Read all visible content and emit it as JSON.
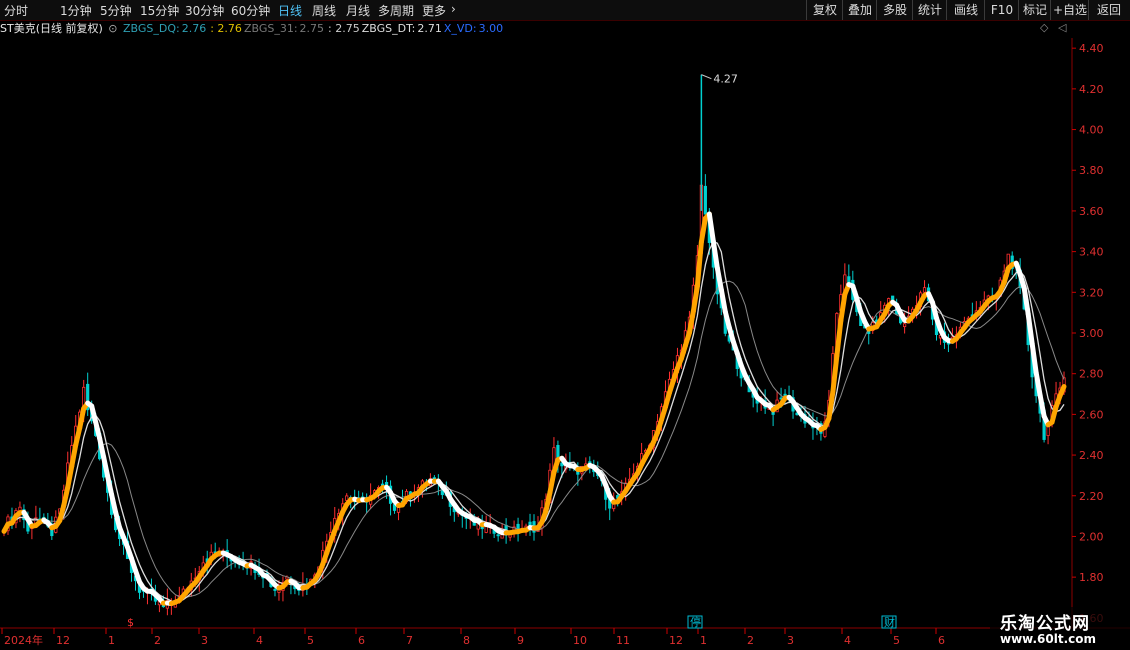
{
  "toolbar": {
    "periods": [
      "分时",
      "1分钟",
      "5分钟",
      "15分钟",
      "30分钟",
      "60分钟",
      "日线",
      "周线",
      "月线",
      "多周期",
      "更多"
    ],
    "active_period": "日线",
    "right_buttons": [
      "复权",
      "叠加",
      "多股",
      "统计",
      "画线",
      "F10",
      "标记",
      "+自选",
      "返回"
    ]
  },
  "legend": {
    "stock": "ST美克(日线 前复权)",
    "items": [
      {
        "name": "ZBGS_DQ:",
        "value": "2.76",
        "name_color": "#2e9fb3",
        "value_color": "#2e9fb3"
      },
      {
        "name": "",
        "value": ": 2.76",
        "name_color": "#e0c000",
        "value_color": "#e0c000"
      },
      {
        "name": "ZBGS_31:",
        "value": "2.75",
        "name_color": "#777777",
        "value_color": "#777777"
      },
      {
        "name": "",
        "value": ": 2.75",
        "name_color": "#cccccc",
        "value_color": "#cccccc"
      },
      {
        "name": "ZBGS_DT:",
        "value": "2.71",
        "name_color": "#dddddd",
        "value_color": "#dddddd"
      },
      {
        "name": "X_VD:",
        "value": "3.00",
        "name_color": "#2a6bff",
        "value_color": "#2a6bff"
      }
    ]
  },
  "chart_data": {
    "type": "candlestick",
    "ylim": [
      1.55,
      4.45
    ],
    "y_ticks": [
      "4.40",
      "4.20",
      "4.00",
      "3.80",
      "3.60",
      "3.40",
      "3.20",
      "3.00",
      "2.80",
      "2.60",
      "2.40",
      "2.20",
      "2.00",
      "1.80",
      "1.60"
    ],
    "x_labels": [
      "2024年",
      "12",
      "1",
      "2",
      "3",
      "4",
      "5",
      "6",
      "7",
      "8",
      "9",
      "10",
      "11",
      "12",
      "1",
      "2",
      "3",
      "4",
      "5",
      "6"
    ],
    "max_label": "4.27",
    "events": [
      {
        "text": "$",
        "month": "1",
        "color": "#ff3333"
      },
      {
        "text": "停",
        "month": "1",
        "color": "#00bcd4"
      },
      {
        "text": "财",
        "month": "4",
        "color": "#00bcd4"
      }
    ],
    "anchors": [
      [
        0,
        2.05
      ],
      [
        4,
        2.15
      ],
      [
        6,
        2.02
      ],
      [
        8,
        2.1
      ],
      [
        10,
        2.05
      ],
      [
        12,
        2.02
      ],
      [
        14,
        2.12
      ],
      [
        17,
        2.45
      ],
      [
        19,
        2.62
      ],
      [
        20,
        2.72
      ],
      [
        21,
        2.62
      ],
      [
        23,
        2.5
      ],
      [
        25,
        2.3
      ],
      [
        28,
        2.05
      ],
      [
        31,
        1.88
      ],
      [
        34,
        1.74
      ],
      [
        37,
        1.7
      ],
      [
        40,
        1.65
      ],
      [
        44,
        1.7
      ],
      [
        47,
        1.78
      ],
      [
        50,
        1.88
      ],
      [
        53,
        1.92
      ],
      [
        56,
        1.9
      ],
      [
        59,
        1.88
      ],
      [
        62,
        1.86
      ],
      [
        65,
        1.82
      ],
      [
        68,
        1.74
      ],
      [
        71,
        1.8
      ],
      [
        74,
        1.75
      ],
      [
        77,
        1.78
      ],
      [
        80,
        1.92
      ],
      [
        83,
        2.1
      ],
      [
        86,
        2.2
      ],
      [
        89,
        2.16
      ],
      [
        92,
        2.2
      ],
      [
        95,
        2.24
      ],
      [
        98,
        2.15
      ],
      [
        101,
        2.2
      ],
      [
        104,
        2.24
      ],
      [
        107,
        2.28
      ],
      [
        110,
        2.22
      ],
      [
        114,
        2.12
      ],
      [
        118,
        2.06
      ],
      [
        122,
        2.04
      ],
      [
        126,
        2.02
      ],
      [
        130,
        2.03
      ],
      [
        134,
        2.05
      ],
      [
        136,
        2.2
      ],
      [
        138,
        2.42
      ],
      [
        140,
        2.35
      ],
      [
        143,
        2.32
      ],
      [
        146,
        2.34
      ],
      [
        149,
        2.3
      ],
      [
        152,
        2.16
      ],
      [
        155,
        2.2
      ],
      [
        158,
        2.32
      ],
      [
        161,
        2.42
      ],
      [
        163,
        2.52
      ],
      [
        166,
        2.7
      ],
      [
        169,
        2.88
      ],
      [
        172,
        3.06
      ],
      [
        174,
        3.38
      ],
      [
        175,
        3.72
      ],
      [
        176,
        3.6
      ],
      [
        178,
        3.3
      ],
      [
        181,
        3.0
      ],
      [
        184,
        2.85
      ],
      [
        187,
        2.7
      ],
      [
        190,
        2.66
      ],
      [
        193,
        2.62
      ],
      [
        196,
        2.7
      ],
      [
        199,
        2.6
      ],
      [
        202,
        2.56
      ],
      [
        205,
        2.5
      ],
      [
        207,
        2.65
      ],
      [
        209,
        3.1
      ],
      [
        211,
        3.3
      ],
      [
        213,
        3.15
      ],
      [
        216,
        3.0
      ],
      [
        219,
        3.05
      ],
      [
        222,
        3.18
      ],
      [
        225,
        3.05
      ],
      [
        228,
        3.1
      ],
      [
        231,
        3.22
      ],
      [
        234,
        3.0
      ],
      [
        237,
        2.95
      ],
      [
        240,
        3.02
      ],
      [
        243,
        3.1
      ],
      [
        246,
        3.15
      ],
      [
        249,
        3.18
      ],
      [
        252,
        3.38
      ],
      [
        254,
        3.3
      ],
      [
        256,
        3.1
      ],
      [
        258,
        2.8
      ],
      [
        261,
        2.5
      ],
      [
        264,
        2.68
      ],
      [
        266,
        2.78
      ]
    ]
  }
}
